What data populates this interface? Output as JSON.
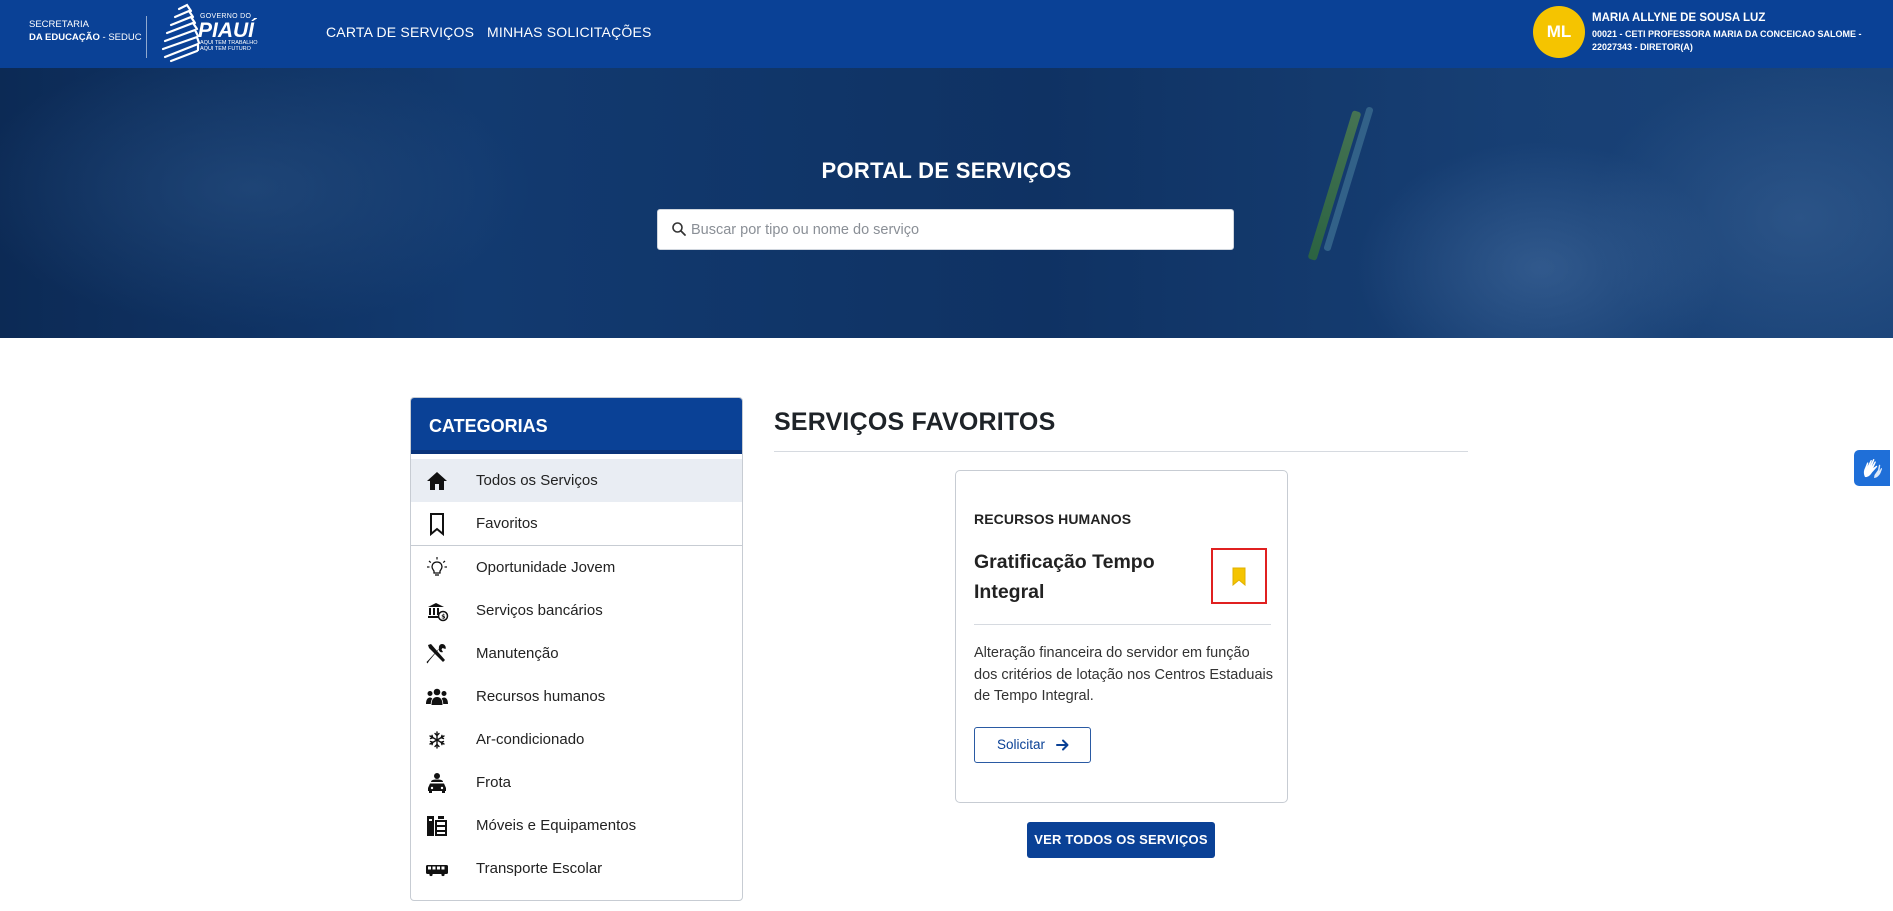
{
  "header": {
    "brand_line1": "SECRETARIA",
    "brand_line2_bold": "DA EDUCAÇÃO",
    "brand_line2_rest": " - SEDUC",
    "gov_small": "GOVERNO DO",
    "gov_big": "PIAUÍ",
    "gov_tag1": "AQUI TEM TRABALHO",
    "gov_tag2": "AQUI TEM FUTURO",
    "nav": [
      "CARTA DE SERVIÇOS",
      "MINHAS SOLICITAÇÕES"
    ],
    "user_initials": "ML",
    "user_name": "MARIA ALLYNE DE SOUSA LUZ",
    "user_info": "00021 - CETI PROFESSORA MARIA DA CONCEICAO SALOME - 22027343 - DIRETOR(A)"
  },
  "hero": {
    "title": "PORTAL DE SERVIÇOS",
    "search_placeholder": "Buscar por tipo ou nome do serviço"
  },
  "categories": {
    "title": "CATEGORIAS",
    "items": [
      {
        "label": "Todos os Serviços",
        "icon": "home-icon"
      },
      {
        "label": "Favoritos",
        "icon": "bookmark-outline-icon"
      },
      {
        "label": "Oportunidade Jovem",
        "icon": "lightbulb-icon"
      },
      {
        "label": "Serviços bancários",
        "icon": "bank-icon"
      },
      {
        "label": "Manutenção",
        "icon": "tools-icon"
      },
      {
        "label": "Recursos humanos",
        "icon": "people-icon"
      },
      {
        "label": "Ar-condicionado",
        "icon": "snowflake-icon"
      },
      {
        "label": "Frota",
        "icon": "driver-car-icon"
      },
      {
        "label": "Móveis e Equipamentos",
        "icon": "furniture-icon"
      },
      {
        "label": "Transporte Escolar",
        "icon": "bus-icon"
      }
    ]
  },
  "favorites": {
    "title": "SERVIÇOS FAVORITOS",
    "card": {
      "category": "RECURSOS HUMANOS",
      "title": "Gratificação Tempo Integral",
      "description": "Alteração financeira do servidor em função dos critérios de lotação nos Centros Estaduais de Tempo Integral.",
      "button": "Solicitar"
    },
    "see_all": "VER TODOS OS SERVIÇOS"
  },
  "colors": {
    "primary": "#0a4196",
    "accent_yellow": "#f5c400",
    "highlight_red": "#e02020"
  }
}
